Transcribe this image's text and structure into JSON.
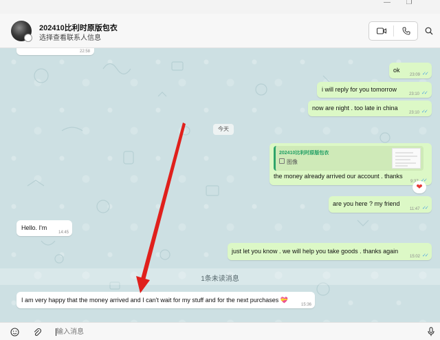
{
  "window": {
    "minimize_glyph": "—",
    "maximize_glyph": "❐"
  },
  "header": {
    "contact_name": "202410比利时原版包衣",
    "contact_subtitle": "选择查看联系人信息",
    "video_call_icon": "video-icon",
    "voice_call_icon": "phone-icon",
    "search_icon": "search-icon"
  },
  "chat": {
    "top_partial_time": "22:58",
    "date_separator": "今天",
    "unread_marker": "1条未读消息",
    "messages": [
      {
        "direction": "out",
        "text": "ok",
        "time": "23:09",
        "status": "read"
      },
      {
        "direction": "out",
        "text": "i will reply for you tomorrow",
        "time": "23:10",
        "status": "read"
      },
      {
        "direction": "out",
        "text": "now are night . too late in china",
        "time": "23:10",
        "status": "read"
      },
      {
        "direction": "out",
        "text": "the money already arrived our account . thanks",
        "time": "9:37",
        "status": "read",
        "quote": {
          "author": "202410比利时原版包衣",
          "type": "图像"
        },
        "reaction": "❤"
      },
      {
        "direction": "out",
        "text": "are you here ? my friend",
        "time": "11:47",
        "status": "read"
      },
      {
        "direction": "in",
        "text": "Hello. I'm",
        "time": "14:45"
      },
      {
        "direction": "out",
        "text": "just let you know . we will help you take goods . thanks again",
        "time": "15:02",
        "status": "read"
      },
      {
        "direction": "in",
        "text": "I am very happy that the money arrived and I can't wait for my stuff and for the next purchases 💝",
        "time": "15:36"
      }
    ]
  },
  "composer": {
    "placeholder": "输入消息",
    "emoji_icon": "emoji-icon",
    "attach_icon": "paperclip-icon",
    "mic_icon": "microphone-icon"
  },
  "colors": {
    "chat_background": "#cde0e3",
    "outgoing_bubble": "#dcf8c6",
    "incoming_bubble": "#ffffff",
    "read_ticks": "#4fa3e0",
    "annotation_arrow": "#e0201c"
  }
}
